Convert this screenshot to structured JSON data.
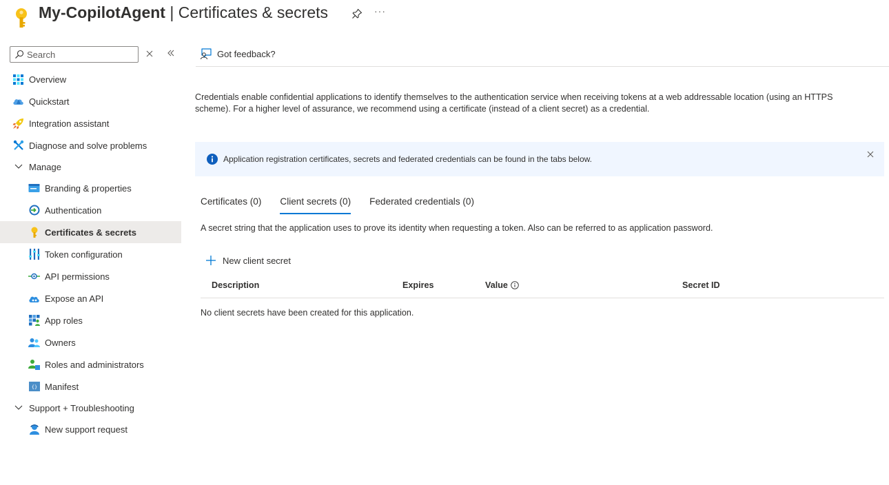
{
  "header": {
    "app_name": "My-CopilotAgent",
    "separator": " | ",
    "page_name": "Certificates & secrets",
    "more_label": "···"
  },
  "sidebar": {
    "search_placeholder": "Search",
    "items": [
      {
        "label": "Overview",
        "icon": "grid-icon"
      },
      {
        "label": "Quickstart",
        "icon": "cloud-icon"
      },
      {
        "label": "Integration assistant",
        "icon": "rocket-icon"
      },
      {
        "label": "Diagnose and solve problems",
        "icon": "wrench-icon"
      },
      {
        "label": "Manage",
        "icon": "chevron-down-icon"
      },
      {
        "label": "Branding & properties",
        "icon": "card-icon"
      },
      {
        "label": "Authentication",
        "icon": "auth-icon"
      },
      {
        "label": "Certificates & secrets",
        "icon": "key-icon",
        "active": true
      },
      {
        "label": "Token configuration",
        "icon": "bars-icon"
      },
      {
        "label": "API permissions",
        "icon": "permission-icon"
      },
      {
        "label": "Expose an API",
        "icon": "cloud-api-icon"
      },
      {
        "label": "App roles",
        "icon": "app-roles-icon"
      },
      {
        "label": "Owners",
        "icon": "users-icon"
      },
      {
        "label": "Roles and administrators",
        "icon": "admin-icon"
      },
      {
        "label": "Manifest",
        "icon": "manifest-icon"
      },
      {
        "label": "Support + Troubleshooting",
        "icon": "chevron-down-icon"
      },
      {
        "label": "New support request",
        "icon": "support-icon"
      }
    ]
  },
  "toolbar": {
    "feedback_label": "Got feedback?"
  },
  "main": {
    "description": "Credentials enable confidential applications to identify themselves to the authentication service when receiving tokens at a web addressable location (using an HTTPS scheme). For a higher level of assurance, we recommend using a certificate (instead of a client secret) as a credential.",
    "info_text": "Application registration certificates, secrets and federated credentials can be found in the tabs below.",
    "tabs": [
      {
        "label": "Certificates (0)"
      },
      {
        "label": "Client secrets (0)",
        "active": true
      },
      {
        "label": "Federated credentials (0)"
      }
    ],
    "tab_description": "A secret string that the application uses to prove its identity when requesting a token. Also can be referred to as application password.",
    "new_button_label": "New client secret",
    "columns": [
      "Description",
      "Expires",
      "Value",
      "Secret ID"
    ],
    "empty_text": "No client secrets have been created for this application."
  },
  "colors": {
    "accent": "#0078d4",
    "key_yellow": "#f8c21a",
    "info_background": "#f0f6ff",
    "active_background": "#edebe9"
  }
}
